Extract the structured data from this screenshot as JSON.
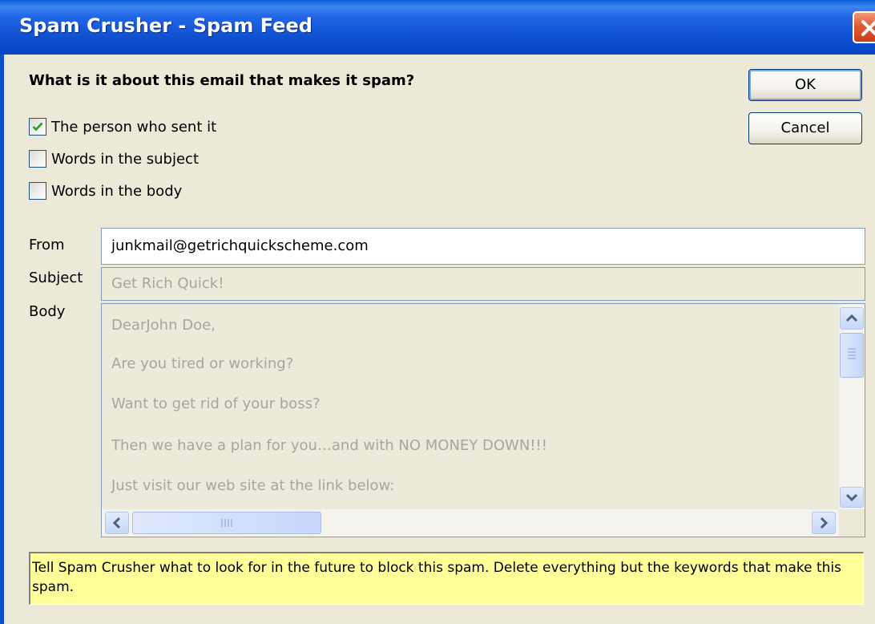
{
  "window": {
    "title": "Spam Crusher - Spam Feed"
  },
  "question": "What is it about this email that makes it spam?",
  "buttons": {
    "ok": "OK",
    "cancel": "Cancel"
  },
  "criteria": [
    {
      "label": "The person who sent it",
      "checked": true
    },
    {
      "label": "Words in the subject",
      "checked": false
    },
    {
      "label": "Words in the body",
      "checked": false
    }
  ],
  "fields": {
    "from_label": "From",
    "from_value": "junkmail@getrichquickscheme.com",
    "subject_label": "Subject",
    "subject_value": "Get Rich Quick!",
    "body_label": "Body",
    "body_lines": [
      "DearJohn Doe,",
      "Are you tired or working?",
      "Want to get rid of your boss?",
      "Then we have a plan for you…and with NO MONEY DOWN!!!",
      "Just visit our web site at the link below:"
    ]
  },
  "hint": "Tell Spam Crusher what to look for in the future to block this spam.  Delete everything but the keywords that make this spam.",
  "icons": {
    "close": "close-icon",
    "check": "checkmark-icon",
    "scroll_up": "arrow-up-icon",
    "scroll_down": "arrow-down-icon",
    "scroll_left": "arrow-left-icon",
    "scroll_right": "arrow-right-icon"
  },
  "colors": {
    "titlebar": "#0a4fd0",
    "hint_background": "#ffff99",
    "dialog_background": "#ece9d8"
  }
}
